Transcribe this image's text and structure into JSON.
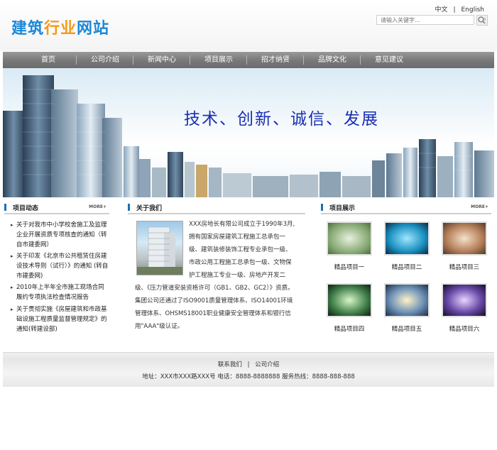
{
  "header": {
    "logo_part1": "建筑",
    "logo_part2": "行业",
    "logo_part3": "网站",
    "lang_zh": "中文",
    "lang_sep": "|",
    "lang_en": "English",
    "search_placeholder": "请输入关键字...",
    "search_icon": "magnifier-icon"
  },
  "nav": {
    "items": [
      "首页",
      "公司介绍",
      "新闻中心",
      "项目展示",
      "招才纳贤",
      "品牌文化",
      "意见建议"
    ]
  },
  "banner": {
    "slogan": "技术、创新、诚信、发展"
  },
  "news": {
    "title": "项目动态",
    "more": "MORE+",
    "items": [
      "关于对我市中小学校舍施工及监理企业开展资质专项核查的通知（转自市建委网）",
      "关于印发《北京市公共租赁住房建设技术导则（试行）》的通知 (转自市建委网)",
      "2010年上半年全市施工现场合同履约专项执法检查情况报告",
      "关于贯彻实施《房屋建筑和市政基础设施工程质量监督管理规定》的通知(转建设部)"
    ]
  },
  "about": {
    "title": "关于我们",
    "text": "XXX房地长有限公司成立于1990年3月,拥有国家房屋建筑工程施工总承包一级、建筑装修装饰工程专业承包一级、市政公用工程施工总承包一级、文物保护工程施工专业一级、房地产开发二级、《压力管道安装资格许可（GB1、GB2、GC2）》资质。集团公司还通过了ISO9001质量管理体系、ISO14001环境管理体系、OHSMS18001职业健康安全管理体系和银行信用\"AAA\"级认证。"
  },
  "projects": {
    "title": "项目展示",
    "more": "MORE+",
    "items": [
      "精品项目一",
      "精品项目二",
      "精品项目三",
      "精品项目四",
      "精品项目五",
      "精品项目六"
    ]
  },
  "footer": {
    "link_contact": "联系我们",
    "link_sep": "|",
    "link_about": "公司介绍",
    "address": "地址：XXX市XXX路XXX号 电话：8888-8888888 服务热线：8888-888-888"
  }
}
